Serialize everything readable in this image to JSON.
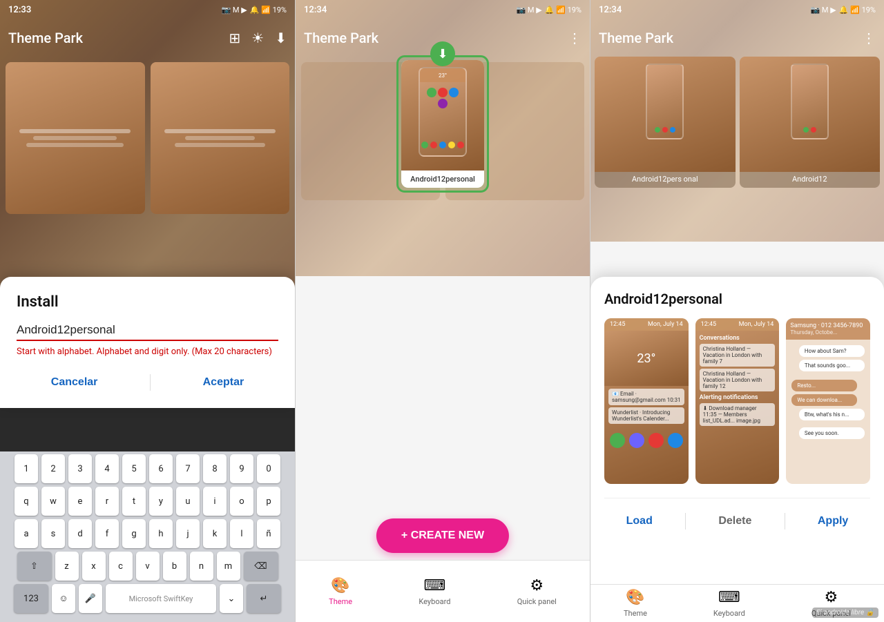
{
  "panel1": {
    "statusBar": {
      "time": "12:33",
      "batteryPct": "19%"
    },
    "appBar": {
      "title": "Theme Park"
    },
    "installDialog": {
      "title": "Install",
      "inputValue": "Android12personal",
      "errorText": "Start with alphabet. Alphabet and digit only. (Max 20 characters)",
      "cancelLabel": "Cancelar",
      "acceptLabel": "Aceptar"
    },
    "keyboard": {
      "rows": [
        [
          "1",
          "2",
          "3",
          "4",
          "5",
          "6",
          "7",
          "8",
          "9",
          "0"
        ],
        [
          "q",
          "w",
          "e",
          "r",
          "t",
          "y",
          "u",
          "i",
          "o",
          "p"
        ],
        [
          "a",
          "s",
          "d",
          "f",
          "g",
          "h",
          "j",
          "k",
          "l",
          "ñ"
        ],
        [
          "⇧",
          "z",
          "x",
          "c",
          "v",
          "b",
          "n",
          "m",
          "⌫"
        ],
        [
          "123",
          "☺",
          "mic",
          "space",
          "↵"
        ]
      ],
      "spaceLabel": "Microsoft SwiftKey"
    }
  },
  "panel2": {
    "statusBar": {
      "time": "12:34",
      "batteryPct": "19%"
    },
    "appBar": {
      "title": "Theme Park",
      "menuIcon": "⋮"
    },
    "featuredTheme": {
      "label": "Android12personal"
    },
    "createNewLabel": "+ CREATE NEW",
    "bottomNav": [
      {
        "icon": "🎨",
        "label": "Theme",
        "active": true
      },
      {
        "icon": "⌨",
        "label": "Keyboard",
        "active": false
      },
      {
        "icon": "⚙",
        "label": "Quick panel",
        "active": false
      }
    ]
  },
  "panel3": {
    "statusBar": {
      "time": "12:34",
      "batteryPct": "19%"
    },
    "appBar": {
      "title": "Theme Park",
      "menuIcon": "⋮"
    },
    "themes": [
      {
        "label": "Android12pers onal"
      },
      {
        "label": "Android12"
      }
    ],
    "detailCard": {
      "title": "Android12personal",
      "actions": {
        "loadLabel": "Load",
        "deleteLabel": "Delete",
        "applyLabel": "Apply"
      }
    },
    "bottomNav": [
      {
        "icon": "🎨",
        "label": "Theme"
      },
      {
        "icon": "⌨",
        "label": "Keyboard"
      },
      {
        "icon": "⚙",
        "label": "Quick panel"
      }
    ],
    "watermark": "El androide libre 🔒"
  }
}
